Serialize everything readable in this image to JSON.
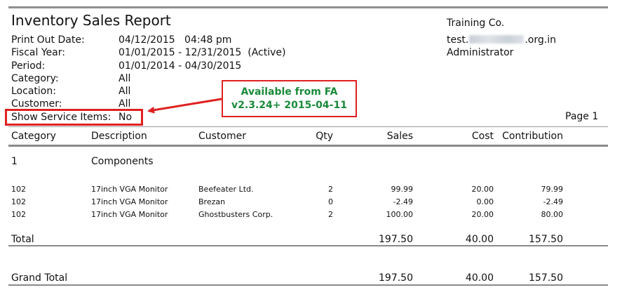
{
  "report": {
    "title": "Inventory Sales Report",
    "meta": [
      {
        "label": "Print Out Date:",
        "value": "04/12/2015   04:48 pm"
      },
      {
        "label": "Fiscal Year:",
        "value": "01/01/2015 - 12/31/2015  (Active)"
      },
      {
        "label": "Period:",
        "value": "01/01/2014 - 04/30/2015"
      },
      {
        "label": "Category:",
        "value": "All"
      },
      {
        "label": "Location:",
        "value": "All"
      },
      {
        "label": "Customer:",
        "value": "All"
      },
      {
        "label": "Show Service Items:",
        "value": "No"
      }
    ],
    "company": {
      "name": "Training Co.",
      "email_prefix": "test.",
      "email_suffix": ".org.in",
      "user": "Administrator"
    },
    "page": "Page 1",
    "columns": [
      "Category",
      "Description",
      "Customer",
      "Qty",
      "Sales",
      "Cost",
      "Contribution"
    ],
    "group": {
      "category": "1",
      "name": "Components"
    },
    "rows": [
      {
        "category": "102",
        "description": "17inch VGA Monitor",
        "customer": "Beefeater Ltd.",
        "qty": "2",
        "sales": "99.99",
        "cost": "20.00",
        "contribution": "79.99"
      },
      {
        "category": "102",
        "description": "17inch VGA Monitor",
        "customer": "Brezan",
        "qty": "0",
        "sales": "-2.49",
        "cost": "0.00",
        "contribution": "-2.49"
      },
      {
        "category": "102",
        "description": "17inch VGA Monitor",
        "customer": "Ghostbusters Corp.",
        "qty": "2",
        "sales": "100.00",
        "cost": "20.00",
        "contribution": "80.00"
      }
    ],
    "total": {
      "label": "Total",
      "sales": "197.50",
      "cost": "40.00",
      "contribution": "157.50"
    },
    "grand_total": {
      "label": "Grand Total",
      "sales": "197.50",
      "cost": "40.00",
      "contribution": "157.50"
    }
  },
  "annotation": {
    "line1": "Available from FA",
    "line2": "v2.3.24+ 2015-04-11",
    "border_color": "#e02020",
    "text_color": "#1a8a3a"
  }
}
